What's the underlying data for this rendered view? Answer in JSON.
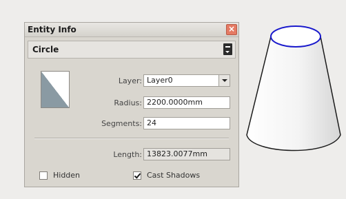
{
  "window": {
    "title": "Entity Info",
    "close_glyph": "×"
  },
  "entity": {
    "type": "Circle"
  },
  "fields": {
    "layer_label": "Layer:",
    "layer_value": "Layer0",
    "radius_label": "Radius:",
    "radius_value": "2200.0000mm",
    "segments_label": "Segments:",
    "segments_value": "24",
    "length_label": "Length:",
    "length_value": "13823.0077mm"
  },
  "options": {
    "hidden_label": "Hidden",
    "hidden_checked": false,
    "cast_shadows_label": "Cast Shadows",
    "cast_shadows_checked": true
  },
  "colors": {
    "selected_edge": "#1a1acc",
    "swatch_shade": "#8a9aa3"
  }
}
